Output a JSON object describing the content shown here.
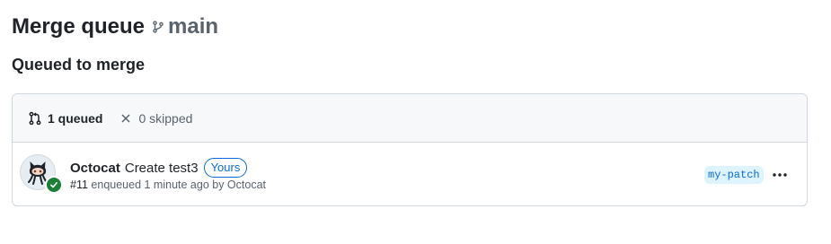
{
  "header": {
    "title": "Merge queue",
    "branch_icon": "git-branch-icon",
    "branch": "main"
  },
  "section": {
    "title": "Queued to merge"
  },
  "queue_summary": {
    "queued_icon": "git-pull-request-icon",
    "queued_label": "1 queued",
    "skipped_icon": "x-icon",
    "skipped_label": "0 skipped"
  },
  "entries": [
    {
      "avatar_icon": "octocat-avatar",
      "status_icon": "check-circle-icon",
      "author": "Octocat",
      "title": "Create test3",
      "badge": "Yours",
      "number": "#11",
      "meta": "enqueued 1 minute ago by Octocat",
      "branch": "my-patch",
      "more_icon": "kebab-horizontal-icon"
    }
  ],
  "colors": {
    "accent": "#0969da",
    "success": "#1a7f37",
    "muted": "#59636e",
    "border": "#d1d9e0"
  }
}
